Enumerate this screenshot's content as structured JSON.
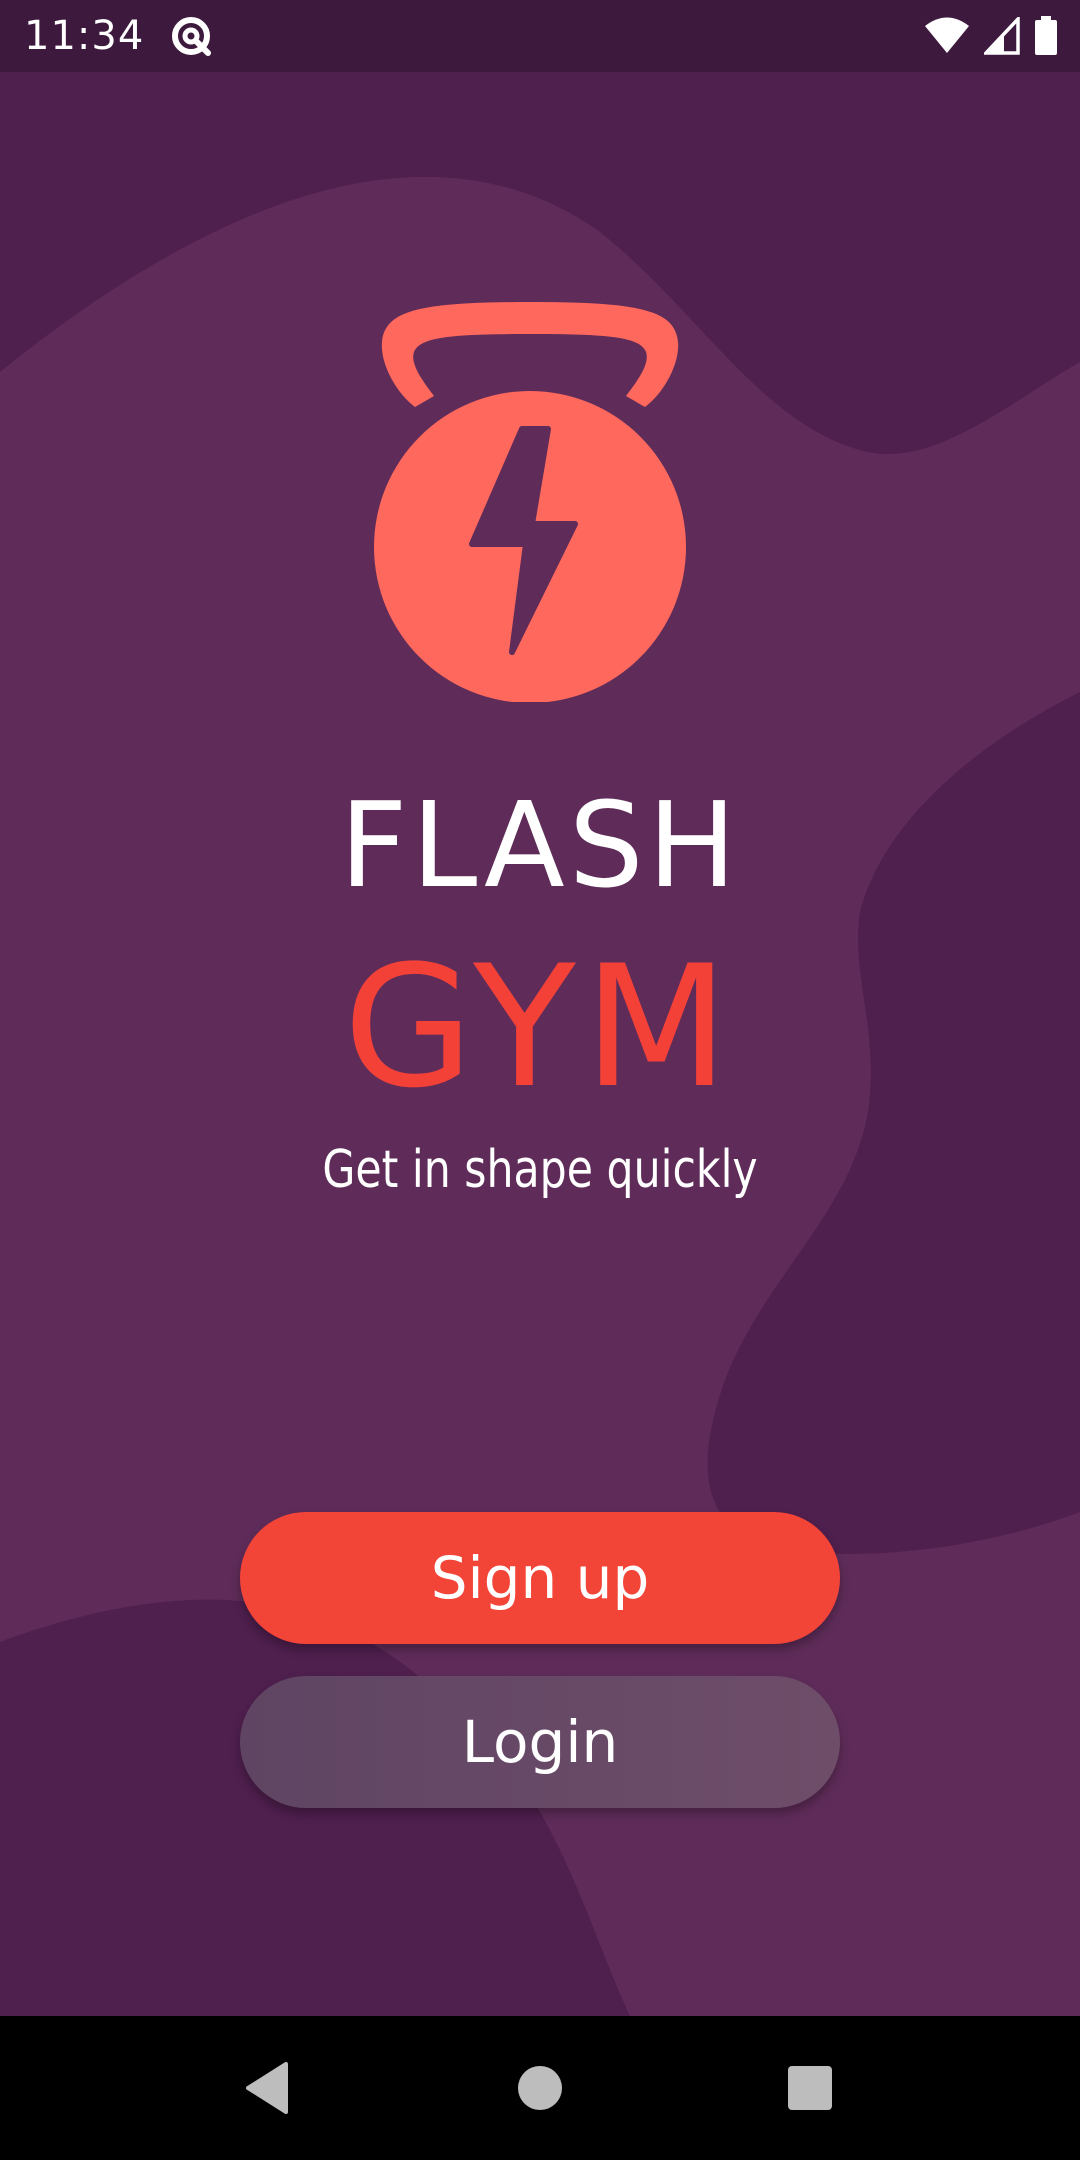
{
  "status_bar": {
    "time": "11:34",
    "icons": [
      "data-saver-icon",
      "wifi-icon",
      "signal-icon",
      "battery-icon"
    ]
  },
  "app": {
    "logo_icon": "kettlebell-lightning-icon",
    "title_line1": "FLASH",
    "title_line2": "GYM",
    "tagline": "Get in shape quickly",
    "signup_label": "Sign up",
    "login_label": "Login"
  },
  "nav_bar": {
    "icons": [
      "back-icon",
      "home-icon",
      "recents-icon"
    ]
  },
  "colors": {
    "background": "#5F2C59",
    "wave_dark": "#4F1F4E",
    "status_bar": "#3D1A3D",
    "accent": "#F34438",
    "logo": "#FF695D",
    "login_button": "#6A4967"
  }
}
